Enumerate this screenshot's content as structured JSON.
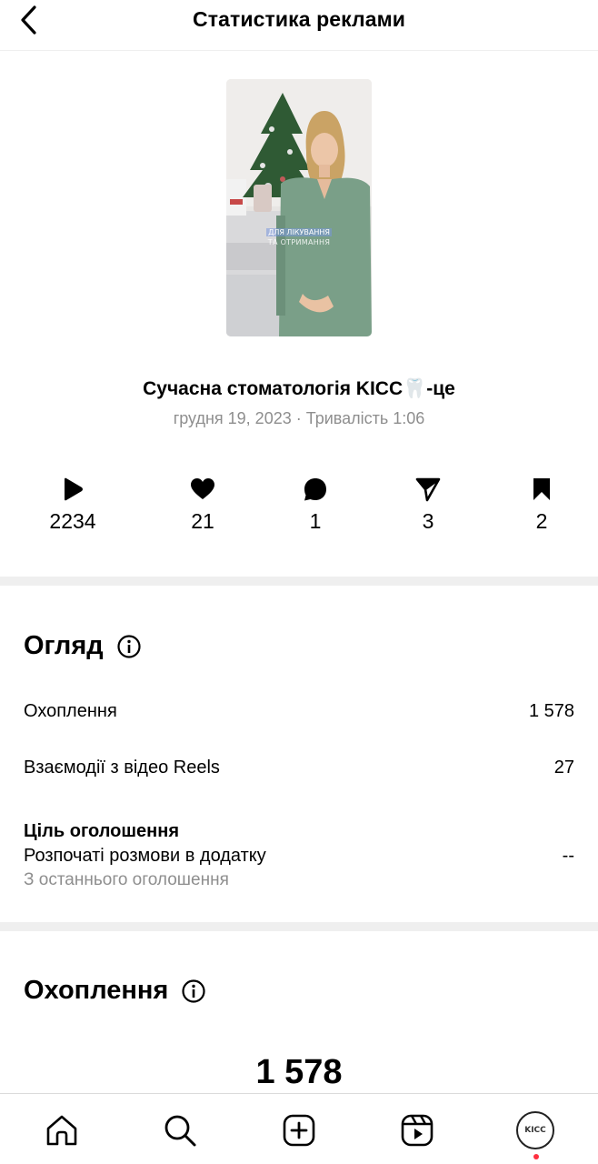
{
  "header": {
    "title": "Статистика реклами"
  },
  "post": {
    "thumbnail_caption_line1": "ДЛЯ ЛІКУВАННЯ",
    "thumbnail_caption_line2": "ТА ОТРИМАННЯ",
    "title": "Сучасна стоматологія KICC🦷-це",
    "meta": "грудня 19, 2023 · Тривалість 1:06"
  },
  "stats": [
    {
      "icon": "play-icon",
      "value": "2234"
    },
    {
      "icon": "heart-icon",
      "value": "21"
    },
    {
      "icon": "comment-icon",
      "value": "1"
    },
    {
      "icon": "share-icon",
      "value": "3"
    },
    {
      "icon": "bookmark-icon",
      "value": "2"
    }
  ],
  "overview": {
    "title": "Огляд",
    "rows": [
      {
        "label": "Охоплення",
        "value": "1 578"
      },
      {
        "label": "Взаємодії з відео Reels",
        "value": "27"
      }
    ],
    "goal_label": "Ціль оголошення",
    "goal_value": "Розпочаті розмови в додатку",
    "goal_sub": "З останнього оголошення",
    "goal_dash": "--"
  },
  "reach": {
    "title": "Охоплення",
    "value": "1 578"
  },
  "bottom_nav": {
    "items": [
      "home-icon",
      "search-icon",
      "create-icon",
      "reels-icon",
      "profile-avatar"
    ],
    "avatar_text": "KICC"
  }
}
